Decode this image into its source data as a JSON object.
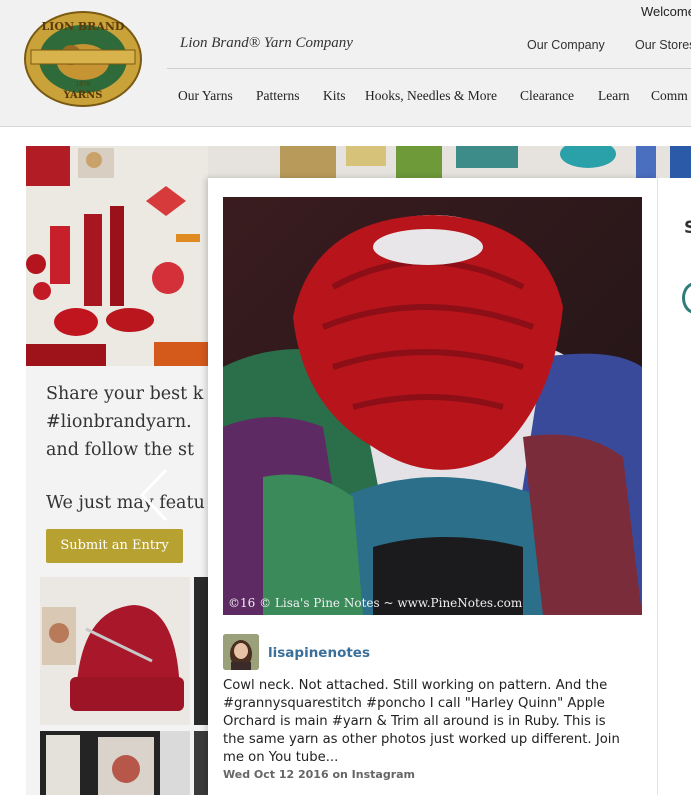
{
  "header": {
    "logo_text_top": "LION BRAND",
    "logo_text_bottom": "YARNS",
    "logo_year": "1878",
    "brand_name": "Lion Brand® Yarn Company",
    "welcome": "Welcome",
    "utility_links": [
      "Our Company",
      "Our Stores"
    ],
    "nav": [
      "Our Yarns",
      "Patterns",
      "Kits",
      "Hooks, Needles & More",
      "Clearance",
      "Learn",
      "Comm"
    ]
  },
  "gallery": {
    "share_lines": [
      "Share your best k",
      "#lionbrandyarn.",
      "and follow the st"
    ],
    "feature_line": "We just may featu",
    "submit_label": "Submit an Entry",
    "prev_icon": "chevron-left-icon"
  },
  "post": {
    "watermark": "©16 © Lisa's Pine Notes ~ www.PineNotes.com",
    "username": "lisapinenotes",
    "caption": "Cowl neck. Not attached. Still working on pattern. And the\n#grannysquarestitch #poncho I call \"Harley Quinn\" Apple\nOrchard is main #yarn & Trim all around is in Ruby. This is\nthe same yarn as other photos just worked up different. Join\nme on You tube...",
    "date": "Wed Oct 12 2016 on Instagram"
  },
  "right_panel": {
    "letter": "S"
  },
  "colors": {
    "header_bg": "#f1f1f1",
    "submit_button": "#b7a131",
    "username": "#3a6f9a",
    "yarn_red": "#b8141c"
  }
}
